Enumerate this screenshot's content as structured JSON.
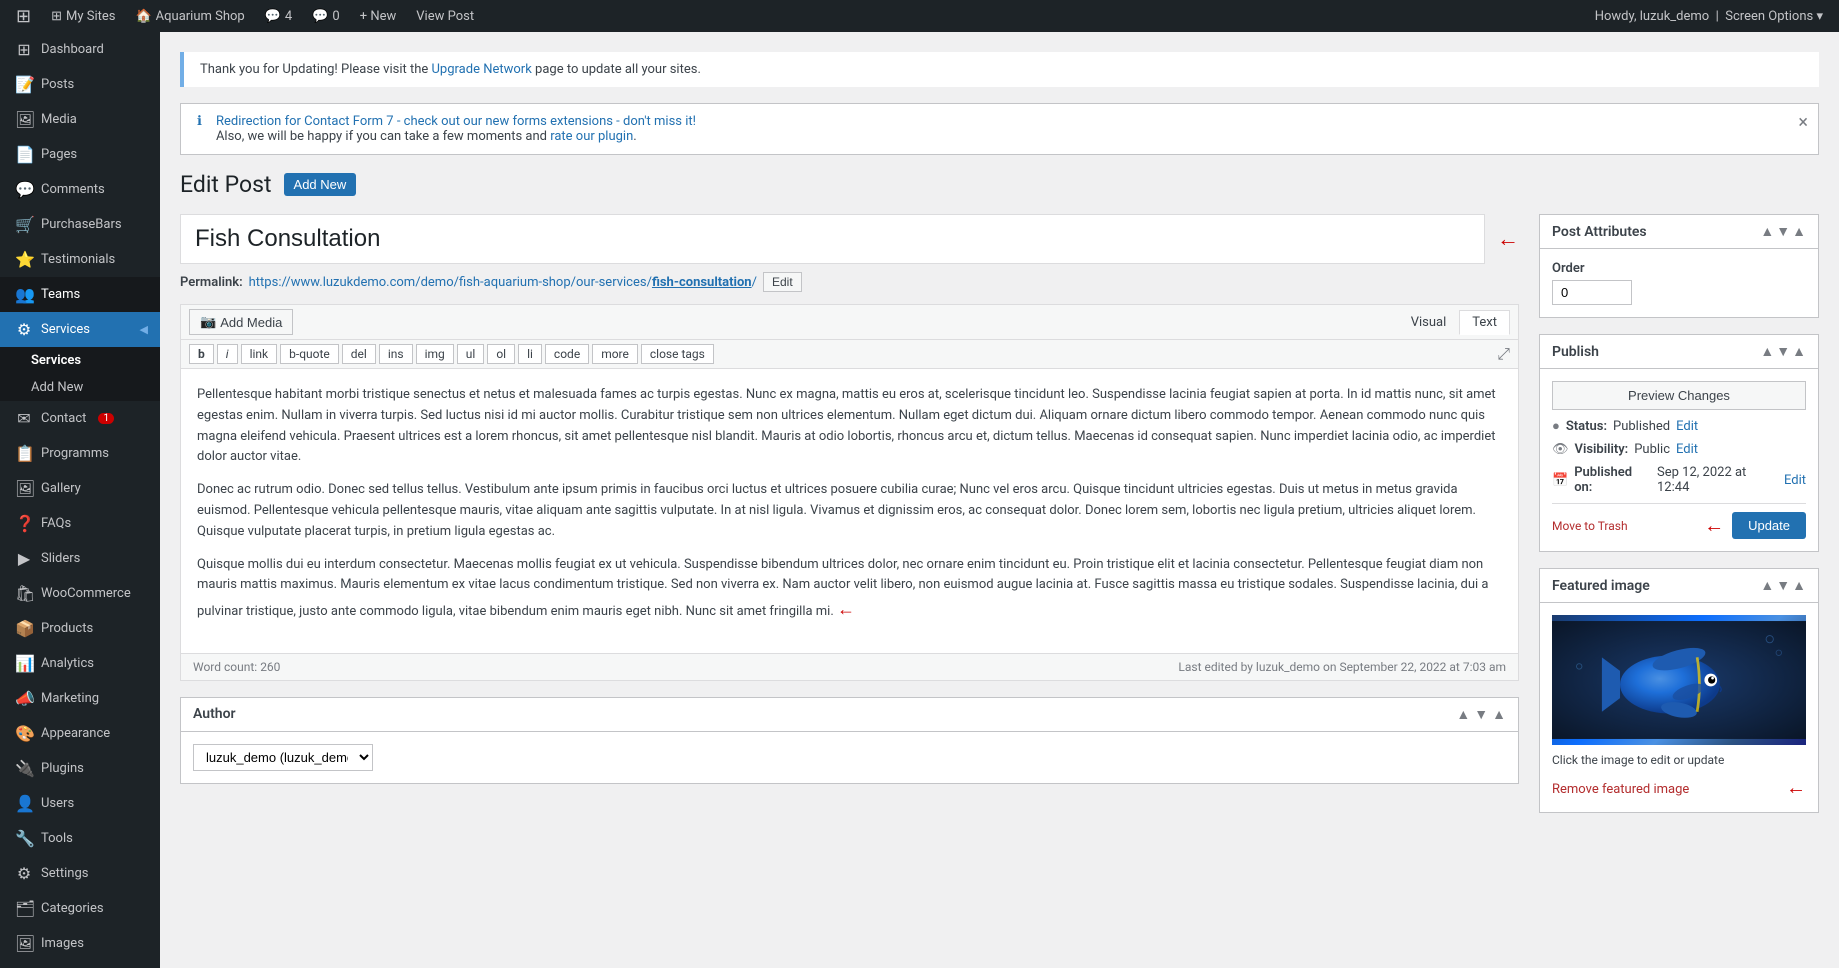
{
  "adminbar": {
    "wp_logo": "⊞",
    "my_sites": "My Sites",
    "site_name": "Aquarium Shop",
    "comments_count": "4",
    "comments_icon_label": "comments",
    "comment_pending": "0",
    "new_label": "+ New",
    "view_post": "View Post",
    "howdy": "Howdy, luzuk_demo",
    "screen_options": "Screen Options"
  },
  "sidebar": {
    "items": [
      {
        "id": "dashboard",
        "icon": "⊞",
        "label": "Dashboard"
      },
      {
        "id": "posts",
        "icon": "📝",
        "label": "Posts"
      },
      {
        "id": "media",
        "icon": "🖼",
        "label": "Media"
      },
      {
        "id": "pages",
        "icon": "📄",
        "label": "Pages"
      },
      {
        "id": "comments",
        "icon": "💬",
        "label": "Comments"
      },
      {
        "id": "purchasebars",
        "icon": "🛒",
        "label": "PurchaseBars"
      },
      {
        "id": "testimonials",
        "icon": "⭐",
        "label": "Testimonials"
      },
      {
        "id": "teams",
        "icon": "👥",
        "label": "Teams"
      },
      {
        "id": "services",
        "icon": "⚙",
        "label": "Services",
        "active": true
      }
    ],
    "submenu": {
      "parent": "Services",
      "items": [
        {
          "id": "services-list",
          "label": "Services",
          "active": true
        },
        {
          "id": "add-new",
          "label": "Add New"
        }
      ]
    },
    "items2": [
      {
        "id": "contact",
        "icon": "✉",
        "label": "Contact",
        "badge": "1"
      },
      {
        "id": "programms",
        "icon": "📋",
        "label": "Programms"
      },
      {
        "id": "gallery",
        "icon": "🖼",
        "label": "Gallery"
      },
      {
        "id": "faqs",
        "icon": "❓",
        "label": "FAQs"
      },
      {
        "id": "sliders",
        "icon": "▶",
        "label": "Sliders"
      },
      {
        "id": "woocommerce",
        "icon": "🛍",
        "label": "WooCommerce"
      },
      {
        "id": "products",
        "icon": "📦",
        "label": "Products"
      },
      {
        "id": "analytics",
        "icon": "📊",
        "label": "Analytics"
      },
      {
        "id": "marketing",
        "icon": "📣",
        "label": "Marketing"
      },
      {
        "id": "appearance",
        "icon": "🎨",
        "label": "Appearance"
      },
      {
        "id": "plugins",
        "icon": "🔌",
        "label": "Plugins"
      },
      {
        "id": "users",
        "icon": "👤",
        "label": "Users"
      },
      {
        "id": "tools",
        "icon": "🔧",
        "label": "Tools"
      },
      {
        "id": "settings",
        "icon": "⚙",
        "label": "Settings"
      },
      {
        "id": "categories",
        "icon": "🗂",
        "label": "Categories"
      },
      {
        "id": "images",
        "icon": "🖼",
        "label": "Images"
      }
    ]
  },
  "notice": {
    "text1": "Thank you for Updating! Please visit the ",
    "link_text": "Upgrade Network",
    "text2": " page to update all your sites."
  },
  "plugin_notice": {
    "line1_pre": "Redirection for Contact Form 7 - check out our new forms extensions - don't miss it!",
    "line2_pre": "Also, we will be happy if you can take a few moments and ",
    "rate_link": "rate our plugin",
    "line2_post": "."
  },
  "page": {
    "title": "Edit Post",
    "add_new_label": "Add New"
  },
  "post": {
    "title": "Fish Consultation",
    "permalink_label": "Permalink:",
    "permalink_url": "https://www.luzukdemo.com/demo/fish-aquarium-shop/our-services/fish-consultation/",
    "permalink_url_display": "https://www.luzukdemo.com/demo/fish-aquarium-shop/our-services/",
    "permalink_slug": "fish-consultation",
    "permalink_slash": "/",
    "edit_slug_label": "Edit"
  },
  "editor": {
    "add_media_label": "Add Media",
    "add_media_icon": "📷",
    "tab_visual": "Visual",
    "tab_text": "Text",
    "buttons": [
      "b",
      "i",
      "link",
      "b-quote",
      "del",
      "ins",
      "img",
      "ul",
      "ol",
      "li",
      "code",
      "more",
      "close tags"
    ],
    "content_p1": "Pellentesque habitant morbi tristique senectus et netus et malesuada fames ac turpis egestas. Nunc ex magna, mattis eu eros at, scelerisque tincidunt leo. Suspendisse lacinia feugiat sapien at porta. In id mattis nunc, sit amet egestas enim. Nullam in viverra turpis. Sed luctus nisi id mi auctor mollis. Curabitur tristique sem non ultrices elementum. Nullam eget dictum dui. Aliquam ornare dictum libero commodo tempor. Aenean commodo nunc quis magna eleifend vehicula. Praesent ultrices est a lorem rhoncus, sit amet pellentesque nisl blandit. Mauris at odio lobortis, rhoncus arcu et, dictum tellus. Maecenas id consequat sapien. Nunc imperdiet lacinia odio, ac imperdiet dolor auctor vitae.",
    "content_p2": "Donec ac rutrum odio. Donec sed tellus tellus. Vestibulum ante ipsum primis in faucibus orci luctus et ultrices posuere cubilia curae; Nunc vel eros arcu. Quisque tincidunt ultricies egestas. Duis ut metus in metus gravida euismod. Pellentesque vehicula pellentesque mauris, vitae aliquam ante sagittis vulputate. In at nisl ligula. Vivamus et dignissim eros, ac consequat dolor. Donec lorem sem, lobortis nec ligula pretium, ultricies aliquet lorem. Quisque vulputate placerat turpis, in pretium ligula egestas ac.",
    "content_p3": "Quisque mollis dui eu interdum consectetur. Maecenas mollis feugiat ex ut vehicula. Suspendisse bibendum ultrices dolor, nec ornare enim tincidunt eu. Proin tristique elit et lacinia consectetur. Pellentesque feugiat diam non mauris mattis maximus. Mauris elementum ex vitae lacus condimentum tristique. Sed non viverra ex. Nam auctor velit libero, non euismod augue lacinia at. Fusce sagittis massa eu tristique sodales. Suspendisse lacinia, dui a pulvinar tristique, justo ante commodo ligula, vitae bibendum enim mauris eget nibh. Nunc sit amet fringilla mi.",
    "word_count_label": "Word count:",
    "word_count": "260",
    "last_edited": "Last edited by luzuk_demo on September 22, 2022 at 7:03 am"
  },
  "author_box": {
    "title": "Author",
    "select_value": "luzuk_demo (luzuk_demo)",
    "select_options": [
      "luzuk_demo (luzuk_demo)"
    ]
  },
  "publish_box": {
    "title": "Publish",
    "preview_btn": "Preview Changes",
    "status_label": "Status:",
    "status_value": "Published",
    "status_edit": "Edit",
    "visibility_label": "Visibility:",
    "visibility_value": "Public",
    "visibility_edit": "Edit",
    "published_label": "Published on:",
    "published_value": "Sep 12, 2022 at 12:44",
    "published_edit": "Edit",
    "trash_label": "Move to Trash",
    "update_btn": "Update"
  },
  "post_attributes": {
    "title": "Post Attributes",
    "order_label": "Order",
    "order_value": "0"
  },
  "featured_image": {
    "title": "Featured image",
    "caption": "Click the image to edit or update",
    "remove_label": "Remove featured image"
  },
  "colors": {
    "accent_blue": "#2271b1",
    "admin_bar_bg": "#1d2327",
    "sidebar_bg": "#1d2327",
    "sidebar_submenu_bg": "#16191c",
    "active_blue": "#2271b1",
    "red_arrow": "#cc0000",
    "trash_red": "#b32d2e"
  }
}
